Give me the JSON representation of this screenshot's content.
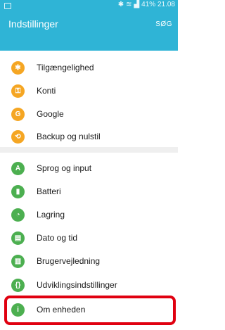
{
  "status": {
    "right_text": "41% 21.08"
  },
  "header": {
    "title": "Indstillinger",
    "search": "SØG"
  },
  "items": [
    {
      "label": "Tilgængelighed",
      "icon": "accessibility-icon",
      "color": "#f5a623",
      "glyph": "✱"
    },
    {
      "label": "Konti",
      "icon": "key-icon",
      "color": "#f5a623",
      "glyph": "⚿"
    },
    {
      "label": "Google",
      "icon": "google-icon",
      "color": "#f5a623",
      "glyph": "G"
    },
    {
      "label": "Backup og nulstil",
      "icon": "backup-icon",
      "color": "#f5a623",
      "glyph": "⟲"
    },
    {
      "label": "Sprog og input",
      "icon": "keyboard-icon",
      "color": "#4caf50",
      "glyph": "A"
    },
    {
      "label": "Batteri",
      "icon": "battery-icon",
      "color": "#4caf50",
      "glyph": "▮"
    },
    {
      "label": "Lagring",
      "icon": "storage-icon",
      "color": "#4caf50",
      "glyph": "◔"
    },
    {
      "label": "Dato og tid",
      "icon": "calendar-icon",
      "color": "#4caf50",
      "glyph": "▤"
    },
    {
      "label": "Brugervejledning",
      "icon": "manual-icon",
      "color": "#4caf50",
      "glyph": "▥"
    },
    {
      "label": "Udviklingsindstillinger",
      "icon": "developer-icon",
      "color": "#4caf50",
      "glyph": "{}"
    },
    {
      "label": "Om enheden",
      "icon": "info-icon",
      "color": "#4caf50",
      "glyph": "i"
    }
  ]
}
